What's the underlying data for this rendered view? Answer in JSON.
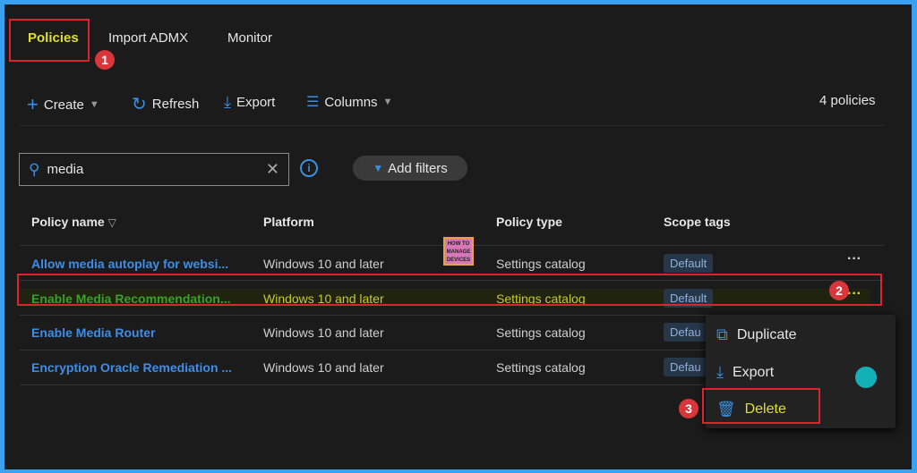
{
  "tabs": [
    {
      "label": "Policies",
      "active": true
    },
    {
      "label": "Import ADMX"
    },
    {
      "label": "Monitor"
    }
  ],
  "toolbar": {
    "create": "Create",
    "refresh": "Refresh",
    "export": "Export",
    "columns": "Columns",
    "count": "4 policies"
  },
  "search": {
    "value": "media"
  },
  "filters": {
    "add_label": "Add filters"
  },
  "table": {
    "headers": [
      "Policy name",
      "Platform",
      "Policy type",
      "Scope tags"
    ],
    "rows": [
      {
        "name": "Allow media autoplay for websi...",
        "platform": "Windows 10 and later",
        "type": "Settings catalog",
        "scope": "Default"
      },
      {
        "name": "Enable Media Recommendation...",
        "platform": "Windows 10 and later",
        "type": "Settings catalog",
        "scope": "Default"
      },
      {
        "name": "Enable Media Router",
        "platform": "Windows 10 and later",
        "type": "Settings catalog",
        "scope": "Defau"
      },
      {
        "name": "Encryption Oracle Remediation ...",
        "platform": "Windows 10 and later",
        "type": "Settings catalog",
        "scope": "Defau"
      }
    ]
  },
  "context_menu": {
    "items": [
      {
        "label": "Duplicate",
        "icon": "copy-icon"
      },
      {
        "label": "Export",
        "icon": "download-icon"
      },
      {
        "label": "Delete",
        "icon": "trash-icon"
      }
    ]
  },
  "annotations": {
    "step1": "1",
    "step2": "2",
    "step3": "3"
  },
  "logo": {
    "text": "HOW TO MANAGE DEVICES"
  },
  "colors": {
    "accent": "#3a8fe0",
    "highlight": "#e0e02a",
    "annotation": "#d9262e",
    "link": "#3d8ee8"
  }
}
